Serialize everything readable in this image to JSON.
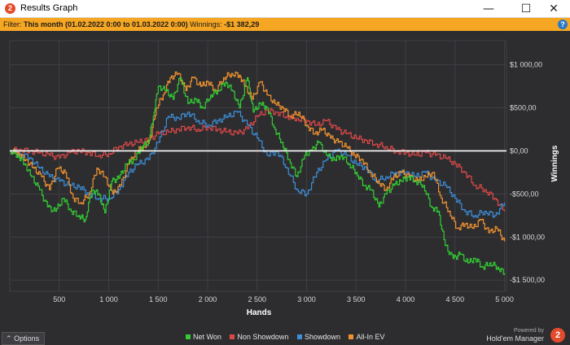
{
  "window": {
    "title": "Results Graph",
    "app_icon": "2",
    "minimize_icon": "minimize-icon",
    "maximize_icon": "maximize-icon",
    "close_icon": "close-icon"
  },
  "filter": {
    "label": "Filter:",
    "value": "This month (01.02.2022 0:00 to 01.03.2022 0:00)",
    "winnings_label": "Winnings:",
    "winnings_value": "-$1 382,29",
    "help_icon": "?"
  },
  "chart_data": {
    "type": "line",
    "xlabel": "Hands",
    "ylabel": "Winnings",
    "xlim": [
      0,
      5020
    ],
    "ylim": [
      -1630,
      1280
    ],
    "x_ticks": [
      500,
      1000,
      1500,
      2000,
      2500,
      3000,
      3500,
      4000,
      4500,
      5000
    ],
    "x_tick_labels": [
      "500",
      "1 000",
      "1 500",
      "2 000",
      "2 500",
      "3 000",
      "3 500",
      "4 000",
      "4 500",
      "5 000"
    ],
    "y_ticks": [
      1000,
      500,
      0,
      -500,
      -1000,
      -1500
    ],
    "y_tick_labels": [
      "$1 000,00",
      "$500,00",
      "$0,00",
      "-$500,00",
      "-$1 000,00",
      "-$1 500,00"
    ],
    "grid": true,
    "legend_position": "bottom",
    "series": [
      {
        "name": "Net Won",
        "color": "#33cc33",
        "x": [
          0,
          80,
          150,
          220,
          300,
          380,
          460,
          540,
          620,
          700,
          760,
          830,
          900,
          960,
          1030,
          1100,
          1180,
          1260,
          1330,
          1400,
          1450,
          1500,
          1580,
          1650,
          1720,
          1800,
          1880,
          1950,
          2030,
          2100,
          2180,
          2250,
          2320,
          2400,
          2460,
          2530,
          2600,
          2680,
          2750,
          2820,
          2900,
          2980,
          3050,
          3120,
          3200,
          3280,
          3350,
          3430,
          3500,
          3580,
          3650,
          3730,
          3800,
          3880,
          3950,
          4030,
          4100,
          4180,
          4260,
          4330,
          4400,
          4480,
          4550,
          4630,
          4700,
          4780,
          4850,
          4930,
          5000
        ],
        "y": [
          0,
          -50,
          -150,
          -300,
          -450,
          -650,
          -700,
          -550,
          -700,
          -750,
          -800,
          -450,
          -500,
          -720,
          -350,
          -320,
          -150,
          -100,
          50,
          100,
          400,
          750,
          700,
          600,
          850,
          550,
          600,
          500,
          650,
          700,
          800,
          700,
          500,
          850,
          450,
          550,
          500,
          250,
          100,
          -100,
          -300,
          -50,
          0,
          100,
          -50,
          -100,
          -50,
          -150,
          -250,
          -400,
          -450,
          -650,
          -500,
          -400,
          -350,
          -300,
          -350,
          -400,
          -650,
          -700,
          -1100,
          -1250,
          -1200,
          -1300,
          -1250,
          -1350,
          -1300,
          -1350,
          -1420
        ]
      },
      {
        "name": "Non Showdown",
        "color": "#e04848",
        "x": [
          0,
          100,
          200,
          300,
          400,
          500,
          600,
          700,
          800,
          900,
          1000,
          1100,
          1200,
          1300,
          1400,
          1500,
          1600,
          1700,
          1800,
          1900,
          2000,
          2100,
          2200,
          2300,
          2400,
          2500,
          2600,
          2700,
          2800,
          2900,
          3000,
          3100,
          3200,
          3300,
          3400,
          3500,
          3600,
          3700,
          3800,
          3900,
          4000,
          4100,
          4200,
          4300,
          4400,
          4500,
          4600,
          4700,
          4800,
          4900,
          5000
        ],
        "y": [
          0,
          20,
          0,
          -20,
          -50,
          -80,
          -20,
          0,
          -20,
          -50,
          -30,
          50,
          80,
          100,
          130,
          200,
          220,
          250,
          280,
          250,
          280,
          250,
          220,
          200,
          260,
          400,
          470,
          450,
          400,
          380,
          350,
          300,
          350,
          250,
          200,
          150,
          120,
          80,
          50,
          0,
          -20,
          -50,
          -20,
          -50,
          -80,
          -150,
          -250,
          -400,
          -450,
          -550,
          -700
        ]
      },
      {
        "name": "Showdown",
        "color": "#3d8fd9",
        "x": [
          0,
          100,
          200,
          300,
          400,
          500,
          600,
          700,
          800,
          900,
          1000,
          1100,
          1200,
          1300,
          1400,
          1500,
          1600,
          1700,
          1800,
          1900,
          2000,
          2100,
          2200,
          2300,
          2400,
          2500,
          2600,
          2700,
          2800,
          2900,
          3000,
          3100,
          3200,
          3300,
          3400,
          3500,
          3600,
          3700,
          3800,
          3900,
          4000,
          4100,
          4200,
          4300,
          4400,
          4500,
          4600,
          4700,
          4800,
          4900,
          5000
        ],
        "y": [
          0,
          -30,
          -80,
          -200,
          -300,
          -350,
          -400,
          -420,
          -500,
          -550,
          -550,
          -450,
          -250,
          -150,
          -100,
          100,
          400,
          380,
          450,
          350,
          300,
          350,
          400,
          450,
          300,
          150,
          -50,
          0,
          -200,
          -450,
          -500,
          -250,
          -100,
          0,
          -50,
          -150,
          -200,
          -350,
          -300,
          -250,
          -250,
          -300,
          -250,
          -350,
          -400,
          -550,
          -700,
          -750,
          -700,
          -750,
          -600
        ]
      },
      {
        "name": "All-In EV",
        "color": "#f0922e",
        "x": [
          0,
          80,
          160,
          240,
          320,
          400,
          480,
          560,
          640,
          720,
          800,
          880,
          960,
          1040,
          1120,
          1200,
          1280,
          1360,
          1420,
          1480,
          1550,
          1620,
          1700,
          1780,
          1850,
          1930,
          2000,
          2080,
          2160,
          2240,
          2320,
          2380,
          2450,
          2530,
          2600,
          2680,
          2760,
          2840,
          2920,
          3000,
          3080,
          3160,
          3240,
          3320,
          3400,
          3480,
          3560,
          3640,
          3720,
          3800,
          3880,
          3960,
          4040,
          4120,
          4200,
          4280,
          4360,
          4440,
          4520,
          4600,
          4680,
          4760,
          4840,
          4920,
          5000
        ],
        "y": [
          0,
          -20,
          -100,
          -200,
          -300,
          -450,
          -200,
          -250,
          -550,
          -600,
          -500,
          -200,
          -300,
          -500,
          -400,
          -150,
          0,
          50,
          150,
          500,
          650,
          850,
          900,
          700,
          850,
          750,
          800,
          700,
          850,
          900,
          880,
          750,
          600,
          800,
          650,
          550,
          500,
          400,
          450,
          300,
          200,
          250,
          150,
          100,
          50,
          -50,
          -100,
          -250,
          -350,
          -450,
          -300,
          -250,
          -300,
          -350,
          -300,
          -250,
          -550,
          -700,
          -900,
          -850,
          -900,
          -800,
          -950,
          -900,
          -1050
        ]
      }
    ]
  },
  "bottom": {
    "options_label": "Options",
    "options_icon": "chevron-up-icon",
    "powered_by": "Powered by",
    "brand_name": "Hold'em Manager",
    "brand_logo": "2"
  }
}
